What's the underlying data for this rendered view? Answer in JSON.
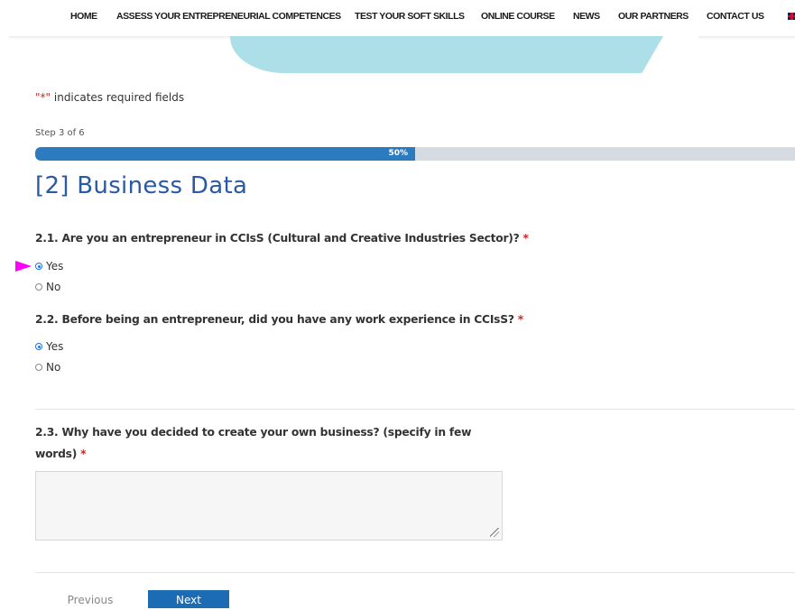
{
  "nav": {
    "items": [
      "HOME",
      "ASSESS YOUR ENTREPRENEURIAL COMPETENCES",
      "TEST YOUR SOFT SKILLS",
      "ONLINE COURSE",
      "NEWS",
      "OUR PARTNERS",
      "CONTACT US"
    ],
    "language_icon": "uk-flag-icon"
  },
  "form": {
    "required_note": {
      "quote_open": "\"",
      "star": "*",
      "quote_close": "\"",
      "text": " indicates required fields"
    },
    "step": "Step 3 of 6",
    "progress": {
      "percent": 50,
      "label": "50%"
    },
    "title": "[2] Business Data",
    "questions": [
      {
        "label": "2.1. Are you an entrepreneur in CCIsS (Cultural and Creative Industries Sector)?",
        "required": "*",
        "options": [
          "Yes",
          "No"
        ],
        "selected": "Yes"
      },
      {
        "label": "2.2. Before being an entrepreneur, did you have any work experience in CCIsS?",
        "required": "*",
        "options": [
          "Yes",
          "No"
        ],
        "selected": "Yes"
      },
      {
        "label_line1": "2.3. Why have you decided to create your own business? (specify in few",
        "label_line2": "words)",
        "required": "*",
        "value": ""
      }
    ],
    "buttons": {
      "previous": "Previous",
      "next": "Next"
    }
  },
  "colors": {
    "accent": "#2a5aa3",
    "progress_fill": "#2d7bbf",
    "required": "#c62828",
    "pointer": "#ff00ff",
    "blob": "#acdfe7"
  }
}
